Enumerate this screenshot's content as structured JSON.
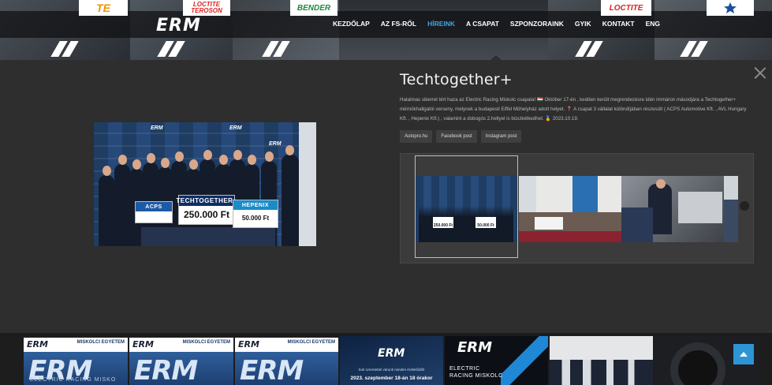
{
  "header": {
    "logo_text": "ERM",
    "nav": [
      {
        "label": "KEZDŐLAP",
        "active": false
      },
      {
        "label": "AZ FS-RŐL",
        "active": false
      },
      {
        "label": "HÍREINK",
        "active": true
      },
      {
        "label": "A CSAPAT",
        "active": false
      },
      {
        "label": "SZPONZORAINK",
        "active": false
      },
      {
        "label": "GYIK",
        "active": false
      },
      {
        "label": "KONTAKT",
        "active": false
      },
      {
        "label": "ENG",
        "active": false
      }
    ],
    "sponsors": [
      "TE",
      "LOCTITE TEROSON",
      "BENDER",
      "LOCTITE"
    ],
    "accent_color": "#3fa4e8"
  },
  "post": {
    "title": "Techtogether+",
    "desc_1": "Hatalmas sikerrel tért haza az Electric Racing Miskolc csapata!",
    "desc_flag": "🇭🇺",
    "desc_2": "Október 17-én , kedden került megrendezésre idén immáron másodjára a Techtogether+ mérnökhallgatói verseny, melynek a budapesti Eiffel Műhelyház adott helyet.",
    "desc_pin": "📍",
    "desc_3": "A csapat 3 vállalat különdíjában részesült ( ACPS Automotive Kft. , AVL Hungary Kft. , Hepenix Kft.) , valamint a dobogós 2.hellyel is büszkélkedhet.",
    "desc_medal": "🏅",
    "desc_date": "2023.10.19.",
    "links": [
      "Autopro.hu",
      "Facebook post",
      "Instagram post"
    ]
  },
  "photo": {
    "backdrop_logo": "ERM",
    "check_big_header": "TECHTOGETHER+",
    "check_big_amount": "250.000 Ft",
    "check_small_amount": "50.000 Ft",
    "check_small_header": "HEPENIX",
    "check_left_header": "ACPS"
  },
  "gallery": {
    "thumb1_label_a": "250.000 Ft",
    "thumb1_label_b": "50.000 Ft"
  },
  "footer": {
    "tiles": [
      {
        "erm": "ERM",
        "uni": "MISKOLCI EGYETEM",
        "big": "ERM",
        "small": "ELECTRIC RACING MISKO"
      },
      {
        "erm": "ERM",
        "uni": "MISKOLCI EGYETEM",
        "big": "ERM",
        "small": ""
      },
      {
        "erm": "ERM",
        "uni": "MISKOLCI EGYETEM",
        "big": "ERM",
        "small": ""
      }
    ],
    "invite_text_a": "Sok szeretettel várunk minden érdeklődőt!",
    "invite_text_b": "2023. szeptember 18-án 18 órakor",
    "invite_logo": "ERM",
    "racing_logo": "ERM",
    "racing_text_a": "ELECTRIC",
    "racing_text_b": "RACING MISKOLC"
  }
}
